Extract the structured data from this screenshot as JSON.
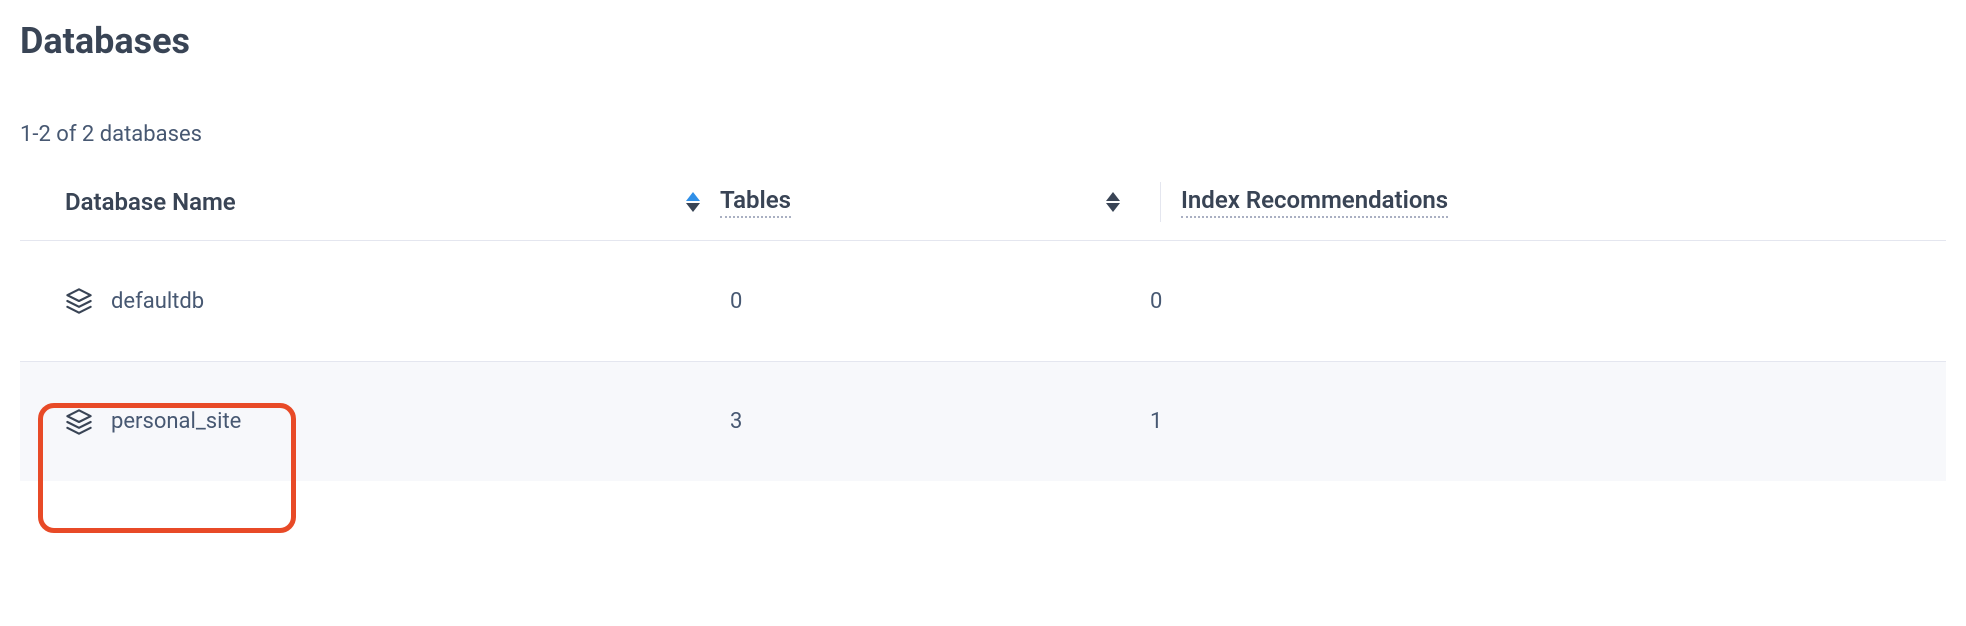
{
  "page": {
    "title": "Databases",
    "count_text": "1-2 of 2 databases"
  },
  "table": {
    "headers": {
      "name": "Database Name",
      "tables": "Tables",
      "index": "Index Recommendations"
    },
    "rows": [
      {
        "name": "defaultdb",
        "tables": "0",
        "index": "0",
        "highlighted": false
      },
      {
        "name": "personal_site",
        "tables": "3",
        "index": "1",
        "highlighted": true
      }
    ]
  }
}
